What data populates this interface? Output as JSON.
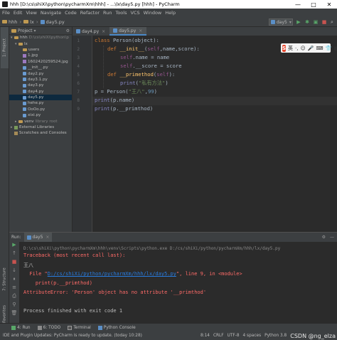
{
  "window": {
    "title": "hhh [D:\\cs\\shiXi\\python\\pycharmXm\\hhh] - ...\\lx\\day5.py [hhh] - PyCharm",
    "min": "—",
    "max": "□",
    "close": "✕"
  },
  "menu": [
    "File",
    "Edit",
    "View",
    "Navigate",
    "Code",
    "Refactor",
    "Run",
    "Tools",
    "VCS",
    "Window",
    "Help"
  ],
  "breadcrumb": [
    "hhh",
    "lx",
    "day5.py"
  ],
  "run_config": "day5",
  "project_panel": {
    "title": "Project",
    "root": {
      "name": "hhh",
      "path": "D:\\cs\\shiXi\\python\\p"
    },
    "folder": "lx",
    "files": [
      "users",
      "1.jpg",
      "1602420259524.jpg",
      "__init__.py",
      "day2.py",
      "day3.1.py",
      "day3.py",
      "day4.py",
      "day5.py",
      "hehe.py",
      "OoOo.py",
      "xixi.py"
    ],
    "venv": {
      "name": "venv",
      "note": "library root"
    },
    "external": "External Libraries",
    "scratches": "Scratches and Consoles"
  },
  "tabs": [
    {
      "label": "day4.py",
      "active": false
    },
    {
      "label": "day5.py",
      "active": true
    }
  ],
  "code_line_numbers": [
    "1",
    "2",
    "3",
    "4",
    "5",
    "6",
    "7",
    "8",
    "9"
  ],
  "code": {
    "l1_kw": "class ",
    "l1_name": "Person",
    "l1_rest": "(object):",
    "l2_kw": "def ",
    "l2_fn": "__init__",
    "l2_p1": "(",
    "l2_self": "self",
    "l2_rest": ",name,score):",
    "l3_self": "self",
    "l3_rest": ".name = name",
    "l4_self": "self",
    "l4_rest": ".__score = score",
    "l5_kw": "def ",
    "l5_fn": "__primethod",
    "l5_p1": "(",
    "l5_self": "self",
    "l5_p2": "):",
    "l6_bi": "print",
    "l6_p1": "(",
    "l6_str": "\"私有方法\"",
    "l6_p2": ")",
    "l7_a": "p = Person(",
    "l7_str": "\"王八\"",
    "l7_b": ",",
    "l7_num": "99",
    "l7_c": ")",
    "l8_bi": "print",
    "l8_rest": "(p.name)",
    "l9_bi": "print",
    "l9_rest": "(p.__primthod)"
  },
  "ime": {
    "logo": "S",
    "lang": "英",
    "items": [
      "·,",
      "☺",
      "🎤",
      "⌨",
      "👕",
      "▦"
    ]
  },
  "run_panel": {
    "label": "Run:",
    "tab": "day5",
    "settings_icon": "⚙",
    "hide_icon": "—"
  },
  "console": {
    "cmd": "D:\\cs\\shiXi\\python\\pycharmXm\\hhh\\venv\\Scripts\\python.exe D:/cs/shiXi/python/pycharmXm/hhh/lx/day5.py",
    "tb_head": "Traceback (most recent call last):",
    "out1": "王八",
    "file_pre": "  File \"",
    "file_link": "D:/cs/shiXi/python/pycharmXm/hhh/lx/day5.py",
    "file_post": "\", line 9, in <module>",
    "code_line": "    print(p.__primthod)",
    "error": "AttributeError: 'Person' object has no attribute '__primthod'",
    "finished": "Process finished with exit code 1"
  },
  "bottom_tools": [
    {
      "label": "4: Run",
      "icon": "run-icon"
    },
    {
      "label": "6: TODO",
      "icon": "todo-icon"
    },
    {
      "label": "Terminal",
      "icon": "terminal-icon"
    },
    {
      "label": "Python Console",
      "icon": "python-console-icon"
    }
  ],
  "statusbar": {
    "message": "IDE and Plugin Updates: PyCharm is ready to update. (today 10:28)",
    "pos": "8:14",
    "crlf": "CRLF",
    "encoding": "UTF-8",
    "indent": "4 spaces",
    "python": "Python 3.8",
    "watermark": "CSDN @ng_elza"
  },
  "colors": {
    "bg_editor": "#2b2b2b",
    "bg_panel": "#3c3f41",
    "keyword": "#cc7832",
    "string": "#6a8759",
    "error": "#ff6b68",
    "link": "#287bde",
    "selection": "#0d293e"
  }
}
